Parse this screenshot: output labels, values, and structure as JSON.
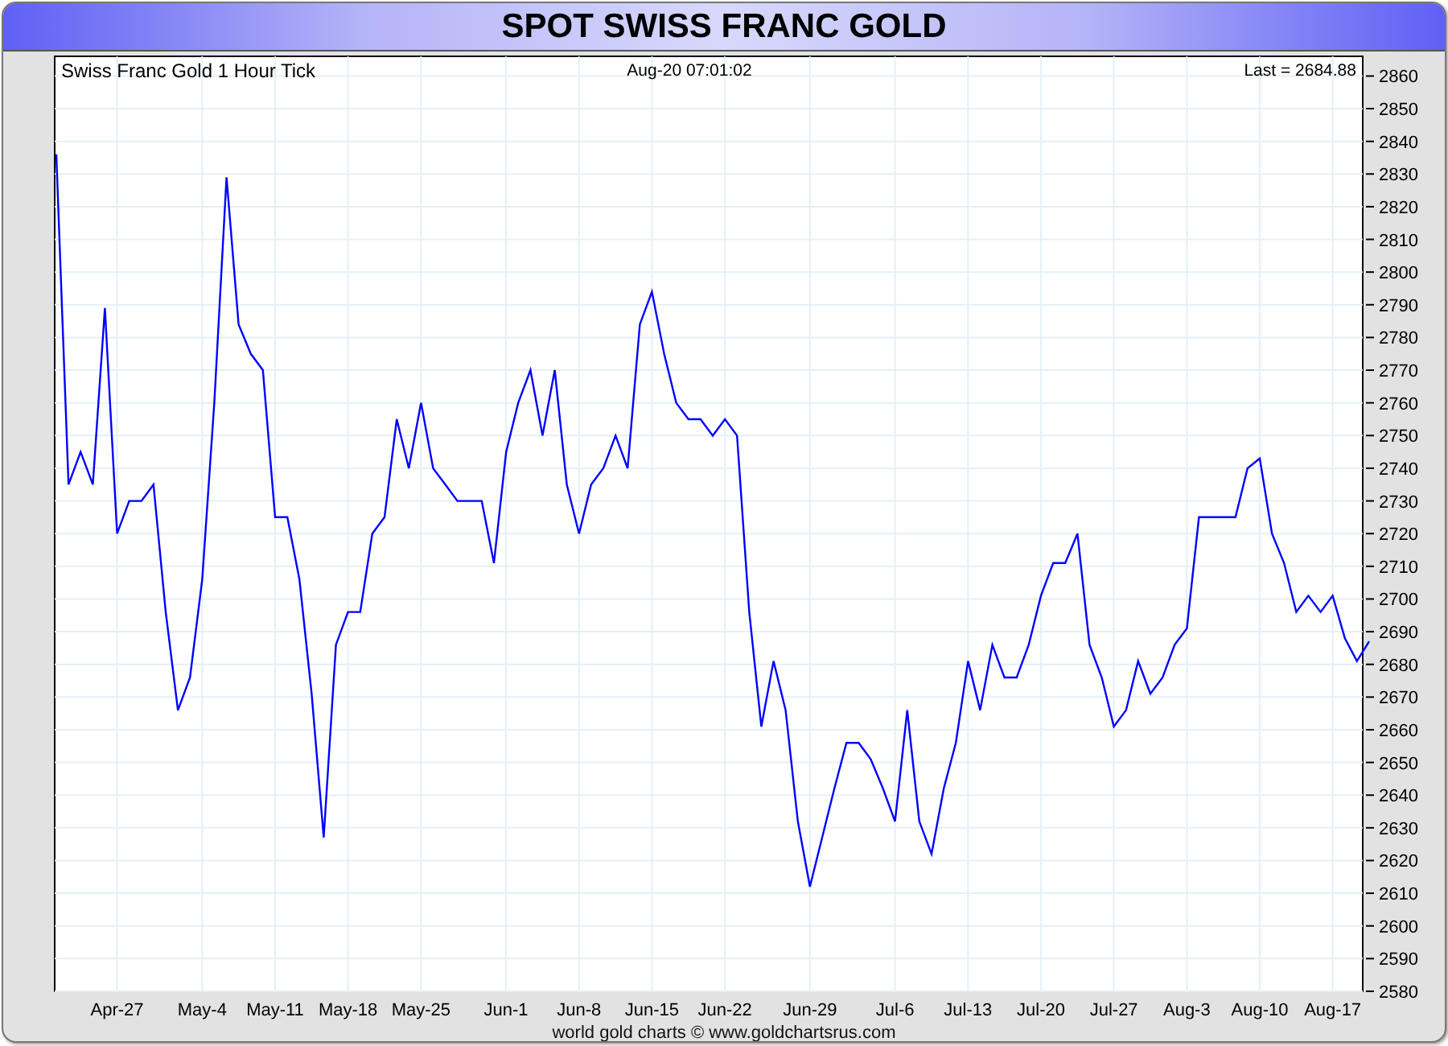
{
  "header": {
    "title": "SPOT SWISS FRANC GOLD"
  },
  "chart": {
    "timestamp": "Aug-20  07:01:02",
    "last": "Last = 2684.88",
    "chart_data": {
      "type": "line",
      "title": "Swiss Franc Gold 1 Hour Tick",
      "grid": true,
      "ylim": [
        2580,
        2866
      ],
      "categories": [
        null,
        null,
        null,
        null,
        null,
        "Apr-27",
        null,
        null,
        null,
        null,
        null,
        null,
        "May-4",
        null,
        null,
        null,
        null,
        null,
        "May-11",
        null,
        null,
        null,
        null,
        null,
        "May-18",
        null,
        null,
        null,
        null,
        null,
        "May-25",
        null,
        null,
        null,
        null,
        null,
        null,
        "Jun-1",
        null,
        null,
        null,
        null,
        null,
        "Jun-8",
        null,
        null,
        null,
        null,
        null,
        "Jun-15",
        null,
        null,
        null,
        null,
        null,
        "Jun-22",
        null,
        null,
        null,
        null,
        null,
        null,
        "Jun-29",
        null,
        null,
        null,
        null,
        null,
        null,
        "Jul-6",
        null,
        null,
        null,
        null,
        null,
        "Jul-13",
        null,
        null,
        null,
        null,
        null,
        "Jul-20",
        null,
        null,
        null,
        null,
        null,
        "Jul-27",
        null,
        null,
        null,
        null,
        null,
        "Aug-3",
        null,
        null,
        null,
        null,
        null,
        "Aug-10",
        null,
        null,
        null,
        null,
        null,
        "Aug-17",
        null,
        null,
        null
      ],
      "yticks": [
        2580,
        2590,
        2600,
        2610,
        2620,
        2630,
        2640,
        2650,
        2660,
        2670,
        2680,
        2690,
        2700,
        2710,
        2720,
        2730,
        2740,
        2750,
        2760,
        2770,
        2780,
        2790,
        2800,
        2810,
        2820,
        2830,
        2840,
        2850,
        2860
      ],
      "series": [
        {
          "color": "#0000ff",
          "values": [
            2836,
            2735,
            2745,
            2735,
            2789,
            2720,
            2730,
            2730,
            2735,
            2696,
            2666,
            2676,
            2706,
            2760,
            2829,
            2784,
            2775,
            2770,
            2725,
            2725,
            2706,
            2671,
            2627,
            2686,
            2696,
            2696,
            2720,
            2725,
            2755,
            2740,
            2760,
            2740,
            2735,
            2730,
            2730,
            2730,
            2711,
            2745,
            2760,
            2770,
            2750,
            2770,
            2735,
            2720,
            2735,
            2740,
            2750,
            2740,
            2784,
            2794,
            2775,
            2760,
            2755,
            2755,
            2750,
            2755,
            2750,
            2696,
            2661,
            2681,
            2666,
            2632,
            2612,
            2627,
            2642,
            2656,
            2656,
            2651,
            2642,
            2632,
            2666,
            2632,
            2622,
            2642,
            2656,
            2681,
            2666,
            2686,
            2676,
            2676,
            2686,
            2701,
            2711,
            2711,
            2720,
            2686,
            2676,
            2661,
            2666,
            2681,
            2671,
            2676,
            2686,
            2691,
            2725,
            2725,
            2725,
            2725,
            2740,
            2743,
            2720,
            2711,
            2696,
            2701,
            2696,
            2701,
            2688,
            2681,
            2687
          ]
        }
      ]
    }
  },
  "footer": {
    "credit": "world gold charts © www.goldchartsrus.com"
  }
}
